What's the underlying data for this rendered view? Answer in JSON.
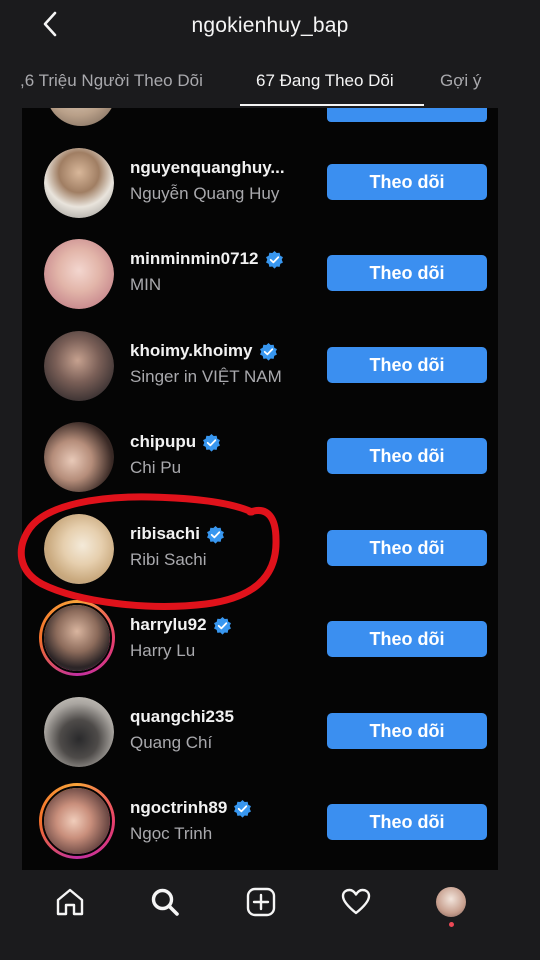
{
  "header": {
    "title": "ngokienhuy_bap"
  },
  "tabs": [
    {
      "label": ",6 Triệu Người Theo Dõi"
    },
    {
      "label": "67 Đang Theo Dõi"
    },
    {
      "label": "Gợi ý"
    }
  ],
  "rows": [
    {
      "username": "nguyenquanghuy...",
      "fullname": "Nguyễn Quang Huy",
      "verified": false,
      "button": "Theo dõi"
    },
    {
      "username": "minminmin0712",
      "fullname": "MIN",
      "verified": true,
      "button": "Theo dõi"
    },
    {
      "username": "khoimy.khoimy",
      "fullname": "Singer in VIỆT NAM",
      "verified": true,
      "button": "Theo dõi"
    },
    {
      "username": "chipupu",
      "fullname": "Chi Pu",
      "verified": true,
      "button": "Theo dõi"
    },
    {
      "username": "ribisachi",
      "fullname": "Ribi Sachi",
      "verified": true,
      "button": "Theo dõi"
    },
    {
      "username": "harrylu92",
      "fullname": "Harry Lu",
      "verified": true,
      "button": "Theo dõi"
    },
    {
      "username": "quangchi235",
      "fullname": "Quang Chí",
      "verified": false,
      "button": "Theo dõi"
    },
    {
      "username": "ngoctrinh89",
      "fullname": "Ngọc Trinh",
      "verified": true,
      "button": "Theo dõi"
    }
  ],
  "icons": {
    "back": "chevron-left-icon",
    "verified": "verified-badge-icon",
    "home": "home-icon",
    "search": "search-icon",
    "create": "plus-square-icon",
    "activity": "heart-icon",
    "profile": "profile-avatar"
  },
  "colors": {
    "accent": "#3b8ff0",
    "annotation": "#e0121b",
    "background": "#050505",
    "chrome": "#1b1b1d"
  }
}
